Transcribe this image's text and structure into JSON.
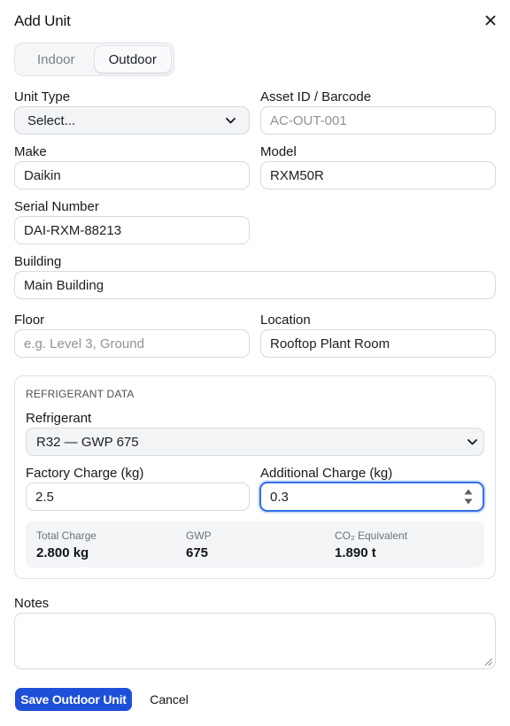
{
  "dialog": {
    "title": "Add Unit"
  },
  "tabs": [
    {
      "label": "Indoor",
      "active": false
    },
    {
      "label": "Outdoor",
      "active": true
    }
  ],
  "fields": {
    "unit_type": {
      "label": "Unit Type",
      "value": "Select..."
    },
    "asset_id": {
      "label": "Asset ID / Barcode",
      "placeholder": "AC-OUT-001"
    },
    "make": {
      "label": "Make",
      "value": "Daikin"
    },
    "model": {
      "label": "Model",
      "value": "RXM50R"
    },
    "serial": {
      "label": "Serial Number",
      "value": "DAI-RXM-88213"
    },
    "building": {
      "label": "Building",
      "value": "Main Building"
    },
    "floor": {
      "label": "Floor",
      "placeholder": "e.g. Level 3, Ground"
    },
    "location": {
      "label": "Location",
      "value": "Rooftop Plant Room"
    }
  },
  "refrigerant": {
    "section_title": "REFRIGERANT DATA",
    "refrigerant_label": "Refrigerant",
    "refrigerant_value": "R32 — GWP 675",
    "factory_label": "Factory Charge (kg)",
    "factory_value": "2.5",
    "additional_label": "Additional Charge (kg)",
    "additional_value": "0.3",
    "summary": {
      "total_label": "Total Charge",
      "total_value": "2.800 kg",
      "gwp_label": "GWP",
      "gwp_value": "675",
      "co2_label": "CO₂ Equivalent",
      "co2_value": "1.890 t"
    }
  },
  "notes": {
    "label": "Notes"
  },
  "actions": {
    "save_label": "Save Outdoor Unit",
    "cancel_label": "Cancel"
  },
  "colors": {
    "primary": "#1d4fd8",
    "focus": "#2f6fe8",
    "border": "#d6dae0"
  }
}
